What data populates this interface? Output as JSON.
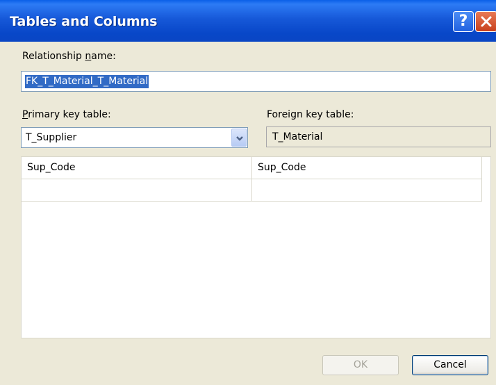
{
  "window": {
    "title": "Tables and Columns",
    "help_label": "?"
  },
  "relationship": {
    "label": "Relationship name:",
    "label_pre": "Relationship ",
    "label_accel": "n",
    "label_post": "ame:",
    "value": "FK_T_Material_T_Material"
  },
  "primary_key": {
    "label": "Primary key table:",
    "label_accel": "P",
    "label_post": "rimary key table:",
    "selected": "T_Supplier"
  },
  "foreign_key": {
    "label": "Foreign key table:",
    "value": "T_Material"
  },
  "columns_grid": {
    "rows": [
      {
        "primary": "Sup_Code",
        "foreign": "Sup_Code"
      },
      {
        "primary": "",
        "foreign": ""
      }
    ]
  },
  "buttons": {
    "ok_label": "OK",
    "cancel_label": "Cancel"
  },
  "colors": {
    "titlebar": "#0a46c4",
    "dialog_bg": "#ece9d8",
    "selection": "#316ac5",
    "close_button": "#c8401c"
  }
}
